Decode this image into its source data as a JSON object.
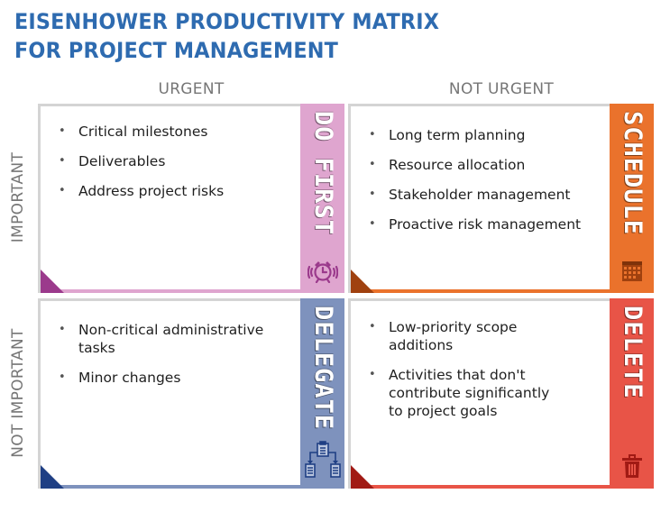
{
  "title": {
    "line1": "EISENHOWER PRODUCTIVITY MATRIX",
    "line2": "FOR PROJECT MANAGEMENT"
  },
  "columns": [
    "URGENT",
    "NOT URGENT"
  ],
  "rows": [
    "IMPORTANT",
    "NOT IMPORTANT"
  ],
  "quadrants": [
    {
      "label": "DO FIRST",
      "icon": "alarm-clock-icon",
      "color": "#dfa5cf",
      "dark": "#9b3a8c",
      "items": [
        "Critical milestones",
        "Deliverables",
        "Address project risks"
      ]
    },
    {
      "label": "SCHEDULE",
      "icon": "calendar-icon",
      "color": "#ea722c",
      "dark": "#a0410f",
      "items": [
        "Long term planning",
        "Resource allocation",
        "Stakeholder management",
        "Proactive risk management"
      ]
    },
    {
      "label": "DELEGATE",
      "icon": "delegate-hierarchy-icon",
      "color": "#7e92bd",
      "dark": "#1f3f84",
      "items": [
        "Non-critical administrative tasks",
        "Minor changes"
      ]
    },
    {
      "label": "DELETE",
      "icon": "trash-icon",
      "color": "#e85447",
      "dark": "#a11a14",
      "items": [
        "Low-priority scope additions",
        "Activities that don't contribute significantly to project goals"
      ]
    }
  ]
}
